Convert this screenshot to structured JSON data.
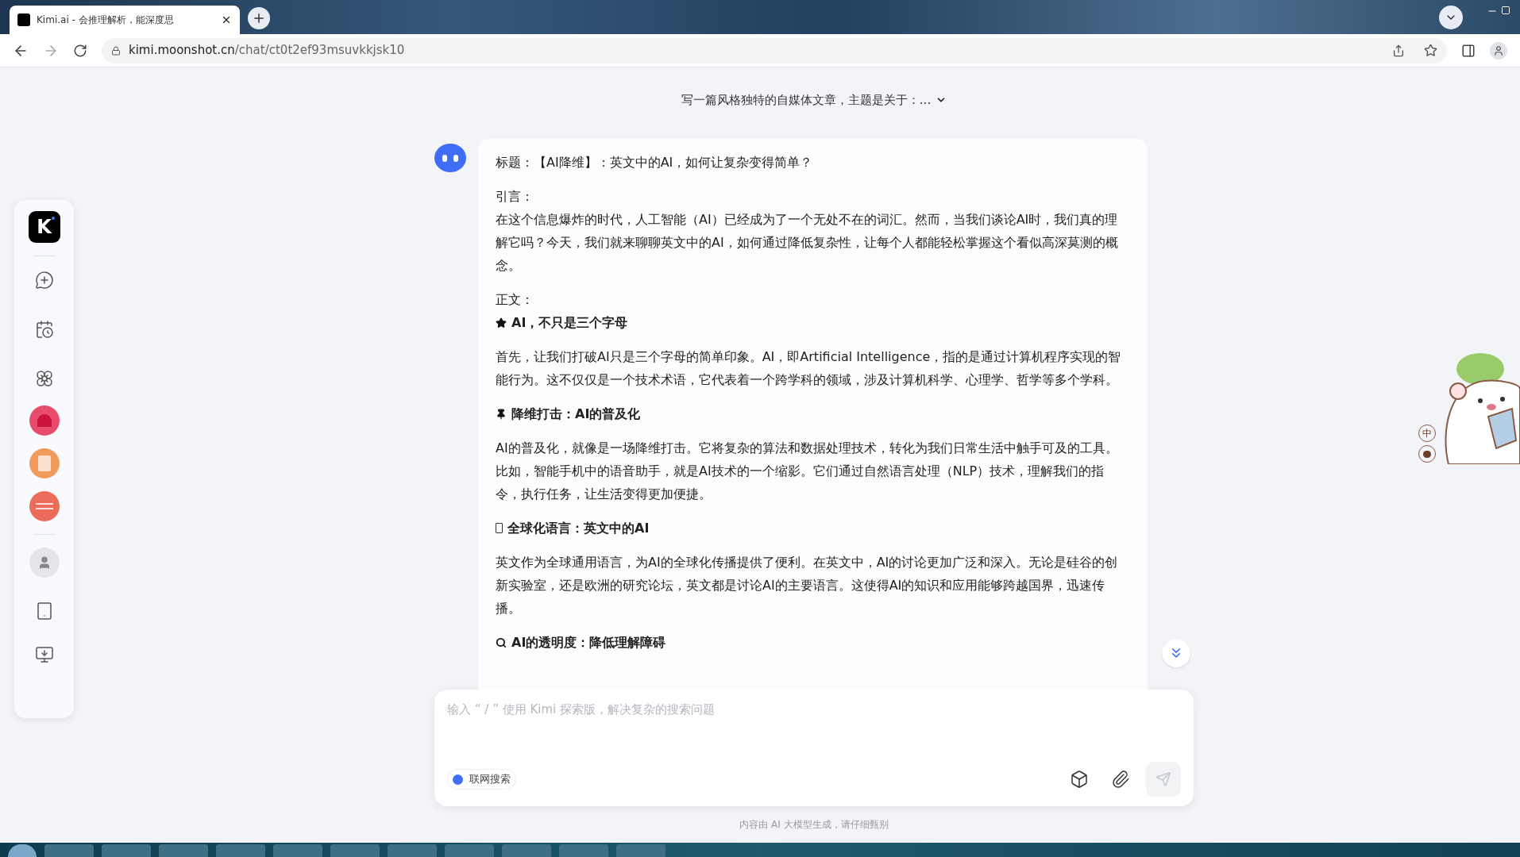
{
  "browser": {
    "tab": {
      "title": "Kimi.ai - 会推理解析，能深度思",
      "selected": true
    },
    "url_host": "kimi.moonshot.cn",
    "url_path": "/chat/ct0t2ef93msuvkkjsk10"
  },
  "sidebar": {
    "logo": "K"
  },
  "chat": {
    "title": "写一篇风格独特的自媒体文章，主题是关于：...",
    "blocks": [
      {
        "kind": "title",
        "text": "标题：【AI降维】：英文中的AI，如何让复杂变得简单？"
      },
      {
        "kind": "label",
        "text": "引言："
      },
      {
        "kind": "paragraph",
        "text": "在这个信息爆炸的时代，人工智能（AI）已经成为了一个无处不在的词汇。然而，当我们谈论AI时，我们真的理解它吗？今天，我们就来聊聊英文中的AI，如何通过降低复杂性，让每个人都能轻松掌握这个看似高深莫测的概念。"
      },
      {
        "kind": "label",
        "text": "正文："
      },
      {
        "kind": "heading",
        "text": "AI，不只是三个字母"
      },
      {
        "kind": "paragraph",
        "text": "首先，让我们打破AI只是三个字母的简单印象。AI，即Artificial Intelligence，指的是通过计算机程序实现的智能行为。这不仅仅是一个技术术语，它代表着一个跨学科的领域，涉及计算机科学、心理学、哲学等多个学科。"
      },
      {
        "kind": "heading",
        "text": "降维打击：AI的普及化"
      },
      {
        "kind": "paragraph",
        "text": "AI的普及化，就像是一场降维打击。它将复杂的算法和数据处理技术，转化为我们日常生活中触手可及的工具。比如，智能手机中的语音助手，就是AI技术的一个缩影。它们通过自然语言处理（NLP）技术，理解我们的指令，执行任务，让生活变得更加便捷。"
      },
      {
        "kind": "heading",
        "text": "全球化语言：英文中的AI"
      },
      {
        "kind": "paragraph",
        "text": "英文作为全球通用语言，为AI的全球化传播提供了便利。在英文中，AI的讨论更加广泛和深入。无论是硅谷的创新实验室，还是欧洲的研究论坛，英文都是讨论AI的主要语言。这使得AI的知识和应用能够跨越国界，迅速传播。"
      },
      {
        "kind": "heading",
        "text": "AI的透明度：降低理解障碍"
      }
    ]
  },
  "input": {
    "placeholder": "输入 “ / ” 使用 Kimi 探索版，解决复杂的搜索问题",
    "web_search": {
      "label": "联网搜索",
      "on": true
    }
  },
  "footer": "内容由 AI 大模型生成，请仔细甄别",
  "ime": {
    "mode": "中"
  }
}
